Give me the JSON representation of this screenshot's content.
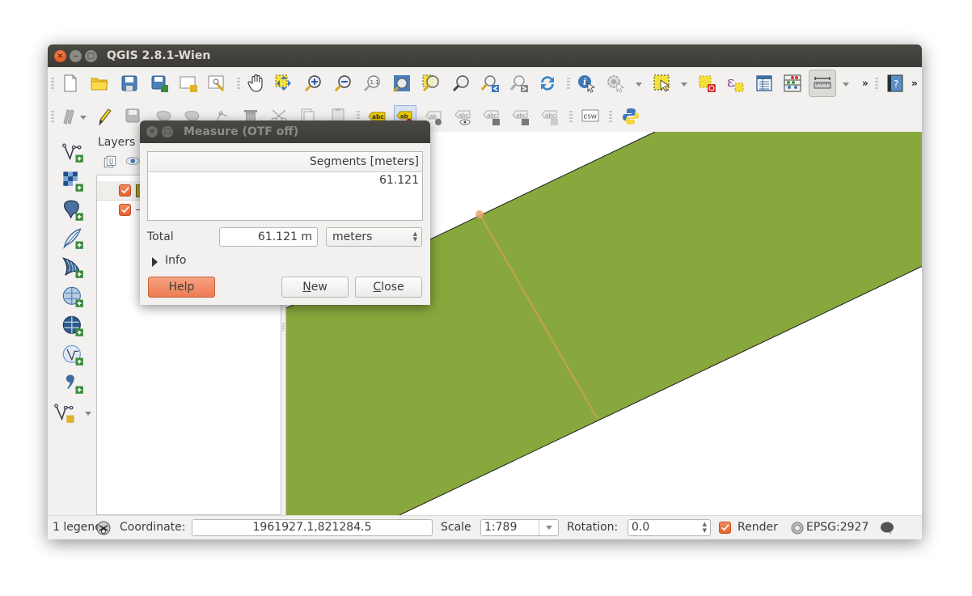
{
  "window": {
    "title": "QGIS 2.8.1-Wien"
  },
  "toolbar_row1": [
    {
      "name": "new-project-icon"
    },
    {
      "name": "open-project-icon"
    },
    {
      "name": "save-project-icon"
    },
    {
      "name": "save-project-as-icon"
    },
    {
      "name": "new-print-composer-icon"
    },
    {
      "name": "composer-manager-icon"
    },
    {
      "name": "pan-map-icon"
    },
    {
      "name": "pan-to-selection-icon"
    },
    {
      "name": "zoom-in-icon"
    },
    {
      "name": "zoom-out-icon"
    },
    {
      "name": "zoom-native-icon"
    },
    {
      "name": "zoom-full-icon"
    },
    {
      "name": "zoom-to-selection-icon"
    },
    {
      "name": "zoom-to-layer-icon"
    },
    {
      "name": "zoom-last-icon"
    },
    {
      "name": "zoom-next-icon"
    },
    {
      "name": "refresh-icon"
    },
    {
      "name": "identify-features-icon"
    },
    {
      "name": "run-feature-action-icon"
    },
    {
      "name": "select-features-icon"
    },
    {
      "name": "deselect-features-icon"
    },
    {
      "name": "select-by-expression-icon"
    },
    {
      "name": "attribute-table-icon"
    },
    {
      "name": "field-calculator-icon"
    },
    {
      "name": "measure-line-icon"
    },
    {
      "name": "help-icon"
    }
  ],
  "toolbar_row2": {
    "csw_label": "CSW",
    "label_tool_text": "abc",
    "label_tool_text_short": "ab"
  },
  "layers_panel": {
    "title": "Layers",
    "layers": [
      {
        "checked": true,
        "symbol_color": "#b59c2b"
      },
      {
        "checked": true,
        "symbol_color": "#7a3f8f"
      }
    ]
  },
  "measure_dialog": {
    "title": "Measure (OTF off)",
    "segments_header": "Segments [meters]",
    "segments": [
      "61.121"
    ],
    "total_label": "Total",
    "total_value": "61.121 m",
    "unit_selected": "meters",
    "info_label": "Info",
    "help_label": "Help",
    "new_label_pre": "",
    "new_label_ul": "N",
    "new_label_post": "ew",
    "close_label_ul": "C",
    "close_label_post": "lose"
  },
  "map": {
    "polygon_fill": "#88a83d",
    "measure_line_color": "#d9a04f"
  },
  "statusbar": {
    "legend_text": "1 legend",
    "coordinate_label": "Coordinate:",
    "coordinate_value": "1961927.1,821284.5",
    "scale_label": "Scale",
    "scale_value": "1:789",
    "rotation_label": "Rotation:",
    "rotation_value": "0.0",
    "render_label": "Render",
    "render_checked": true,
    "crs_label": "EPSG:2927"
  }
}
